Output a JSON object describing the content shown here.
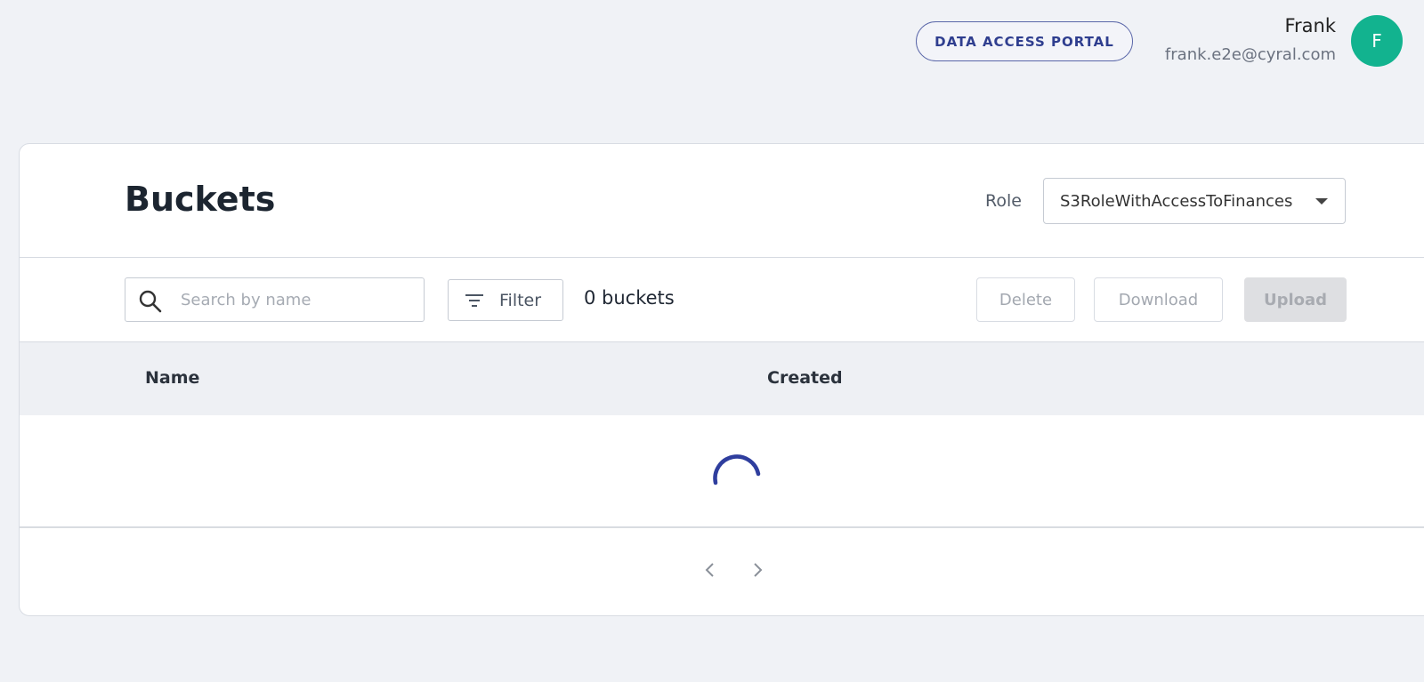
{
  "header": {
    "portal_badge": "DATA ACCESS PORTAL",
    "user_name": "Frank",
    "user_email": "frank.e2e@cyral.com",
    "avatar_initial": "F",
    "avatar_color": "#12b38f"
  },
  "page": {
    "title": "Buckets",
    "role_label": "Role",
    "role_selected": "S3RoleWithAccessToFinances"
  },
  "toolbar": {
    "search_placeholder": "Search by name",
    "filter_label": "Filter",
    "count_text": "0 buckets",
    "delete_label": "Delete",
    "download_label": "Download",
    "upload_label": "Upload"
  },
  "table": {
    "columns": [
      "Name",
      "Created"
    ],
    "loading": true
  },
  "colors": {
    "accent": "#2f3e8f",
    "spinner": "#2f3e9e"
  }
}
